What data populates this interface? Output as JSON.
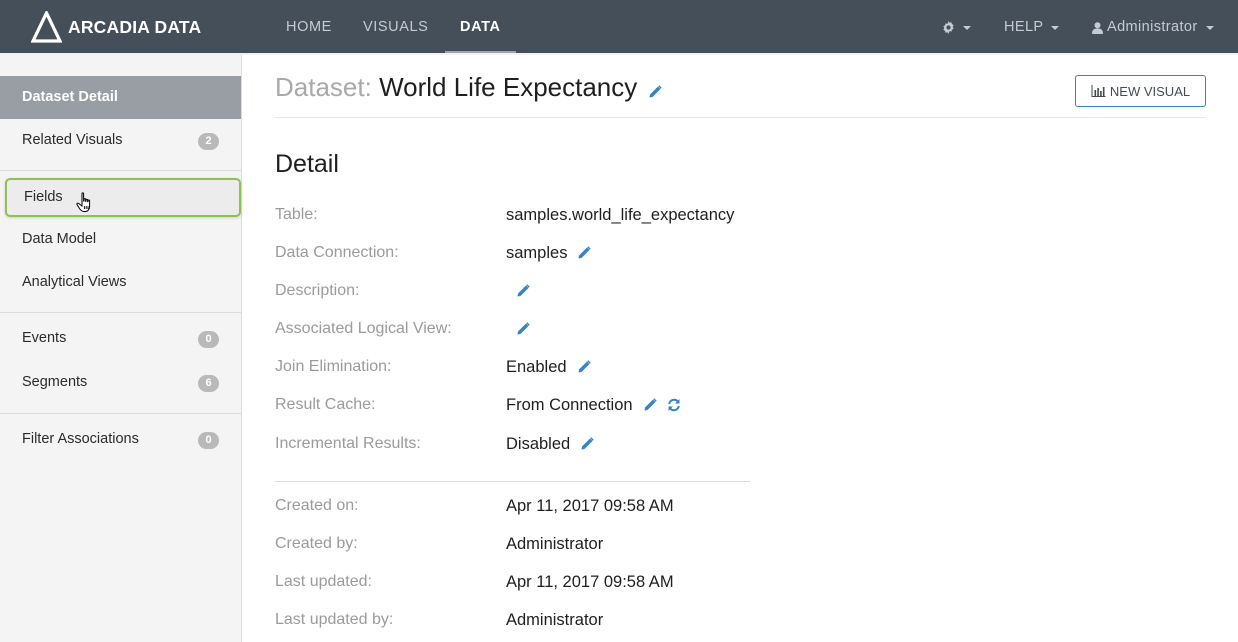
{
  "app": {
    "brand": "ARCADIA DATA",
    "accent_color": "#3b83c0",
    "nav_bg_color": "#454f59",
    "highlight_color": "#8dc155"
  },
  "topnav": {
    "items": [
      {
        "label": "HOME",
        "active": false
      },
      {
        "label": "VISUALS",
        "active": false
      },
      {
        "label": "DATA",
        "active": true
      }
    ],
    "settings_icon": "gear-icon",
    "help_label": "HELP",
    "user_icon": "user-icon",
    "user_label": "Administrator"
  },
  "sidebar": {
    "items": [
      {
        "label": "Dataset Detail",
        "badge": null,
        "state": "active"
      },
      {
        "label": "Related Visuals",
        "badge": "2"
      },
      {
        "label": "Fields",
        "badge": null,
        "state": "hover"
      },
      {
        "label": "Data Model",
        "badge": null
      },
      {
        "label": "Analytical Views",
        "badge": null
      },
      {
        "label": "Events",
        "badge": "0"
      },
      {
        "label": "Segments",
        "badge": "6"
      },
      {
        "label": "Filter Associations",
        "badge": "0"
      }
    ]
  },
  "header": {
    "title_prefix": "Dataset:",
    "title": "World Life Expectancy",
    "new_visual_label": "NEW VISUAL"
  },
  "detail": {
    "section_title": "Detail",
    "rows": [
      {
        "label": "Table:",
        "value": "samples.world_life_expectancy"
      },
      {
        "label": "Data Connection:",
        "value": "samples"
      },
      {
        "label": "Description:",
        "value": ""
      },
      {
        "label": "Associated Logical View:",
        "value": ""
      },
      {
        "label": "Join Elimination:",
        "value": "Enabled"
      },
      {
        "label": "Result Cache:",
        "value": "From Connection"
      },
      {
        "label": "Incremental Results:",
        "value": "Disabled"
      }
    ],
    "meta": [
      {
        "label": "Created on:",
        "value": "Apr 11, 2017 09:58 AM"
      },
      {
        "label": "Created by:",
        "value": "Administrator"
      },
      {
        "label": "Last updated:",
        "value": "Apr 11, 2017 09:58 AM"
      },
      {
        "label": "Last updated by:",
        "value": "Administrator"
      }
    ]
  }
}
